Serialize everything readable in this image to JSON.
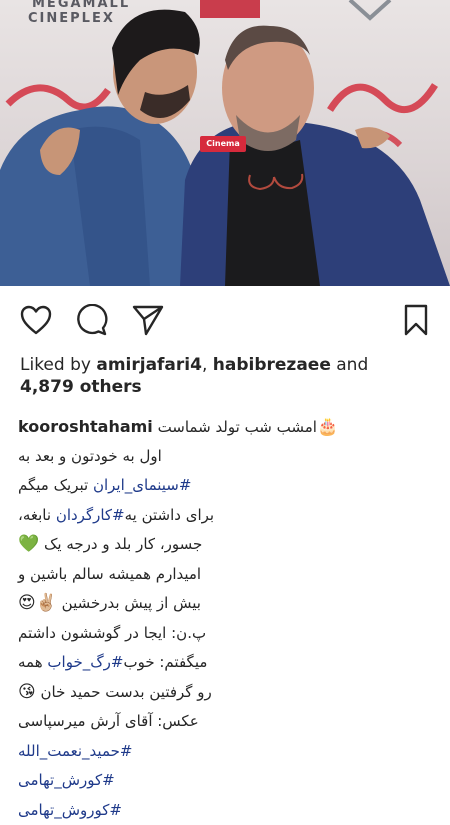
{
  "photo": {
    "brand_top": "MEGAMALL",
    "brand_bottom": "CINEPLEX",
    "sign_text": "Cinema"
  },
  "actions": {
    "like_icon": "heart-icon",
    "comment_icon": "comment-icon",
    "share_icon": "share-icon",
    "save_icon": "bookmark-icon"
  },
  "likes": {
    "prefix": "Liked by ",
    "user1": "amirjafari4",
    "separator": ", ",
    "user2": "habibrezaee",
    "and": " and",
    "others": "4,879 others"
  },
  "caption": {
    "username": "kooroshtahami",
    "lines": {
      "l1": "امشب شب تولد شماست",
      "l1_emoji": "🎂",
      "l2": "اول به خودتون و بعد به",
      "l3_tag": "#سینمای_ایران",
      "l3": " تبریک میگم",
      "l4_a": "برای داشتن یه",
      "l4_tag": "#کارگردان",
      "l4_b": " نابغه،",
      "l5": "جسور، کار بلد و درجه یک",
      "l5_emoji": "💚",
      "l6": "امیدارم همیشه سالم باشین و",
      "l7": "بیش از پیش بدرخشین",
      "l7_emoji": "✌🏼😍",
      "l8": "پ.ن: ایجا در گوششون داشتم",
      "l9_a": "میگفتم: خوب",
      "l9_tag": "#رگ_خواب",
      "l9_b": " همه",
      "l10": "رو گرفتین بدست حمید خان",
      "l10_emoji": "😘",
      "l11": "عکس: آقای آرش میرسپاسی",
      "l12_tag": "#حمید_نعمت_الله",
      "l13_tag": "#کورش_تهامی",
      "l14_tag": "#کوروش_تهامی"
    }
  }
}
